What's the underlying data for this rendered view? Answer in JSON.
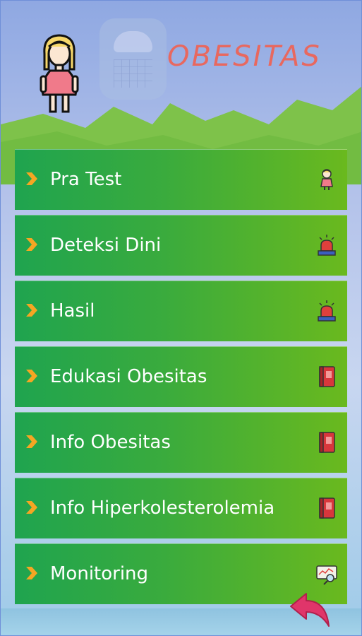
{
  "header": {
    "title": "OBESITAS"
  },
  "menu": {
    "items": [
      {
        "label": "Pra Test",
        "icon": "girl-icon"
      },
      {
        "label": "Deteksi Dini",
        "icon": "siren-icon"
      },
      {
        "label": "Hasil",
        "icon": "siren-icon"
      },
      {
        "label": "Edukasi Obesitas",
        "icon": "book-icon"
      },
      {
        "label": "Info Obesitas",
        "icon": "book-icon"
      },
      {
        "label": "Info Hiperkolesterolemia",
        "icon": "book-icon"
      },
      {
        "label": "Monitoring",
        "icon": "monitoring-icon"
      }
    ]
  },
  "colors": {
    "accent": "#e8685f",
    "menu_start": "#1fa44f",
    "menu_end": "#6ab91e",
    "chevron": "#f5a623",
    "back_arrow": "#e0356a"
  }
}
